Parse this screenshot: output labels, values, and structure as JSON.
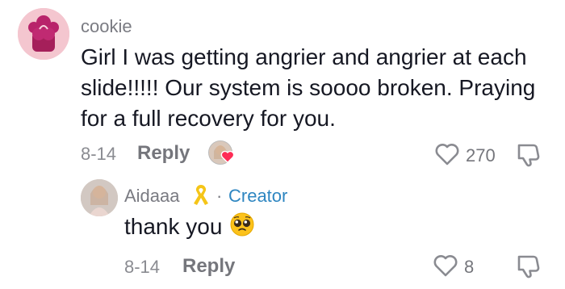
{
  "comment": {
    "username": "cookie",
    "text": "Girl I was getting angrier and angrier at each slide!!!!! Our system is soooo broken. Praying for a full recovery for you.",
    "date": "8-14",
    "reply_label": "Reply",
    "like_count": "270",
    "icons": {
      "like": "heart-outline-icon",
      "dislike": "thumbs-down-icon",
      "liked_by_creator": "heart-badge-icon"
    }
  },
  "reply": {
    "username": "Aidaaa",
    "separator": "·",
    "badge": "Creator",
    "text": "thank you",
    "date": "8-14",
    "reply_label": "Reply",
    "like_count": "8",
    "icons": {
      "ribbon": "yellow-ribbon-icon",
      "emoji": "pleading-face-emoji",
      "like": "heart-outline-icon",
      "dislike": "thumbs-down-icon"
    }
  },
  "colors": {
    "text": "#161823",
    "muted": "#75767c",
    "creator": "#2e86c1",
    "heart": "#fe2c55",
    "ribbon": "#f5c518"
  }
}
